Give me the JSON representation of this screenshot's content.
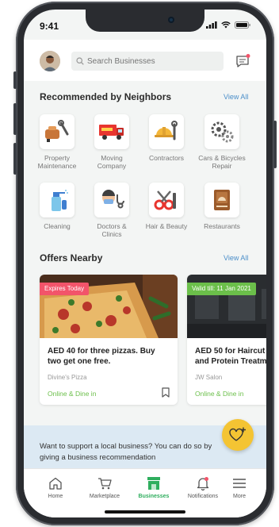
{
  "status_bar": {
    "time": "9:41"
  },
  "header": {
    "search_placeholder": "Search Businesses"
  },
  "recommended": {
    "title": "Recommended by Neighbors",
    "view_all": "View All",
    "categories": [
      {
        "label": "Property Maintenance",
        "icon": "paint-roller-wrench-icon"
      },
      {
        "label": "Moving Company",
        "icon": "moving-truck-icon"
      },
      {
        "label": "Contractors",
        "icon": "hard-hat-wrench-icon"
      },
      {
        "label": "Cars & Bicycles Repair",
        "icon": "gears-icon"
      },
      {
        "label": "Cleaning",
        "icon": "spray-bottle-icon"
      },
      {
        "label": "Doctors & Clinics",
        "icon": "doctor-stethoscope-icon"
      },
      {
        "label": "Hair & Beauty",
        "icon": "scissors-comb-icon"
      },
      {
        "label": "Restaurants",
        "icon": "menu-board-icon"
      }
    ]
  },
  "offers": {
    "title": "Offers Nearby",
    "view_all": "View All",
    "items": [
      {
        "tag": "Expires Today",
        "tag_color": "#f2546a",
        "title_line1": "AED 40 for three pizzas. Buy",
        "title_line2": "two get one free.",
        "business": "Divine's Pizza",
        "mode": "Online & Dine in"
      },
      {
        "tag": "Valid till: 11 Jan 2021",
        "tag_color": "#6bbf4a",
        "title_line1": "AED 50 for Haircut",
        "title_line2": "and Protein Treatment",
        "business": "JW Salon",
        "mode": "Online & Dine in"
      }
    ]
  },
  "banner": {
    "line1": "Want to support a local business? You can do so by",
    "line2": "giving a business recommendation"
  },
  "tabs": [
    {
      "label": "Home",
      "icon": "home-icon",
      "active": false
    },
    {
      "label": "Marketplace",
      "icon": "cart-icon",
      "active": false
    },
    {
      "label": "Businesses",
      "icon": "storefront-icon",
      "active": true
    },
    {
      "label": "Notifications",
      "icon": "bell-icon",
      "active": false
    },
    {
      "label": "More",
      "icon": "hamburger-icon",
      "active": false
    }
  ],
  "colors": {
    "accent_blue": "#4a8ec9",
    "accent_green": "#2fae5e",
    "fab_yellow": "#f4c433"
  }
}
